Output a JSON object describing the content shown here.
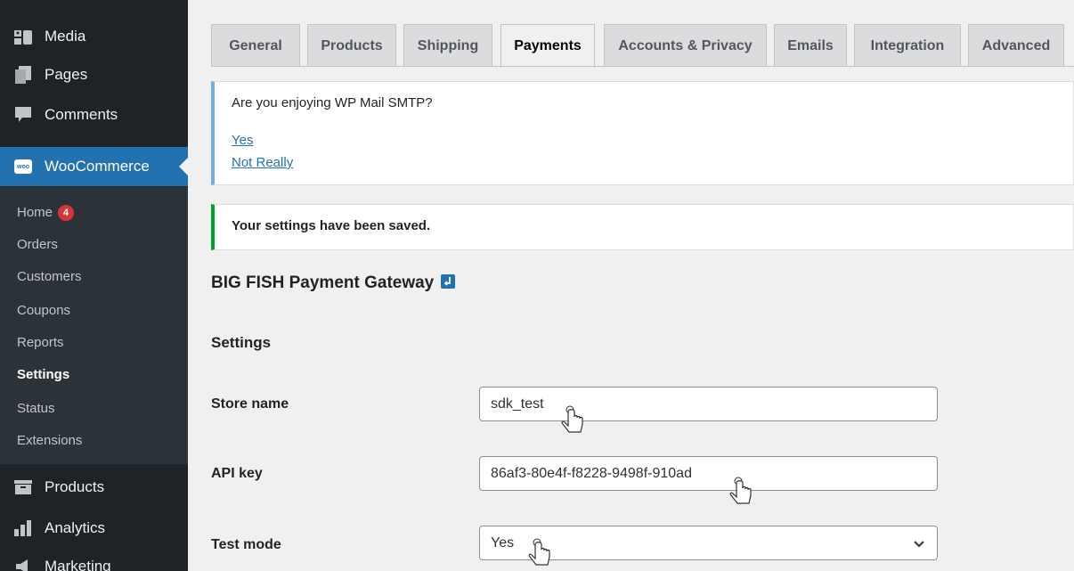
{
  "sidebar": {
    "top_items": [
      {
        "label": "Media",
        "icon": "media-icon"
      },
      {
        "label": "Pages",
        "icon": "pages-icon"
      },
      {
        "label": "Comments",
        "icon": "comments-icon"
      }
    ],
    "active_item": {
      "label": "WooCommerce",
      "icon": "woocommerce-icon",
      "logo_text": "woo"
    },
    "submenu": [
      {
        "label": "Home",
        "badge": "4"
      },
      {
        "label": "Orders"
      },
      {
        "label": "Customers"
      },
      {
        "label": "Coupons"
      },
      {
        "label": "Reports"
      },
      {
        "label": "Settings",
        "current": true
      },
      {
        "label": "Status"
      },
      {
        "label": "Extensions"
      }
    ],
    "bottom_items": [
      {
        "label": "Products",
        "icon": "products-icon"
      },
      {
        "label": "Analytics",
        "icon": "analytics-icon"
      },
      {
        "label": "Marketing",
        "icon": "marketing-icon"
      }
    ]
  },
  "tabs": [
    {
      "label": "General"
    },
    {
      "label": "Products"
    },
    {
      "label": "Shipping"
    },
    {
      "label": "Payments",
      "active": true
    },
    {
      "label": "Accounts & Privacy"
    },
    {
      "label": "Emails"
    },
    {
      "label": "Integration"
    },
    {
      "label": "Advanced"
    }
  ],
  "notices": {
    "smtp": {
      "question": "Are you enjoying WP Mail SMTP?",
      "yes": "Yes",
      "no": "Not Really"
    },
    "saved": {
      "text": "Your settings have been saved."
    }
  },
  "gateway": {
    "title": "BIG FISH Payment Gateway",
    "settings_heading": "Settings",
    "fields": {
      "store_name": {
        "label": "Store name",
        "value": "sdk_test"
      },
      "api_key": {
        "label": "API key",
        "value": "86af3-80e4f-f8228-9498f-910ad"
      },
      "test_mode": {
        "label": "Test mode",
        "value": "Yes"
      }
    }
  },
  "colors": {
    "accent": "#2271b1",
    "sidebar_bg": "#1d2327",
    "submenu_bg": "#2c3338",
    "badge": "#d63638",
    "success": "#00a32a",
    "info": "#72aee6"
  }
}
